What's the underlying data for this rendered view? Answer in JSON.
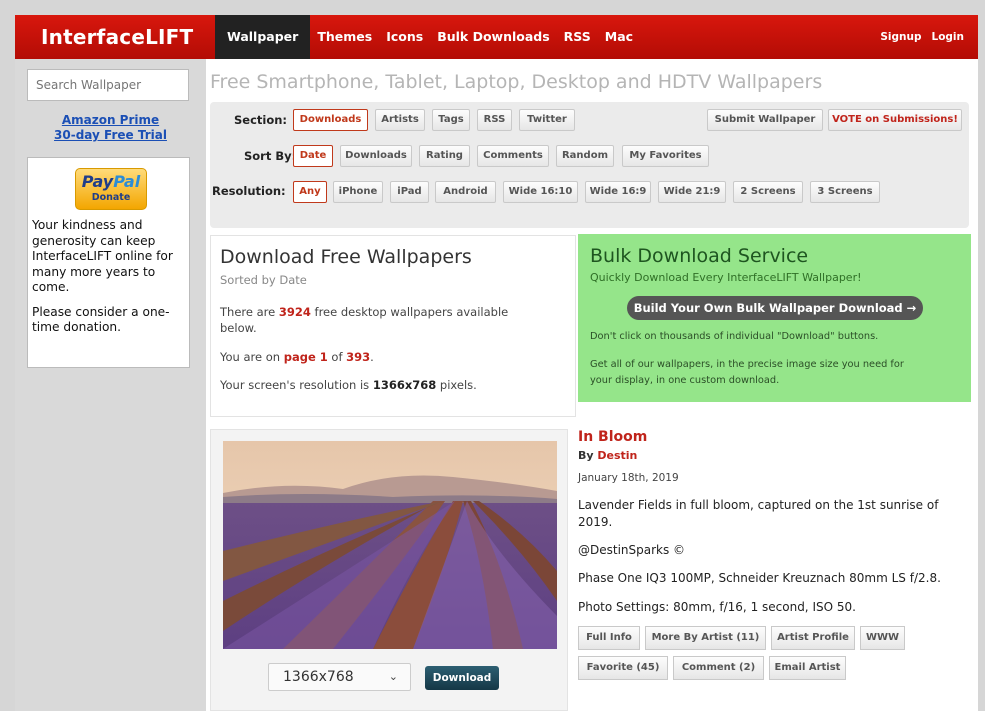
{
  "header": {
    "logo": "InterfaceLIFT",
    "nav": [
      "Wallpaper",
      "Themes",
      "Icons",
      "Bulk Downloads",
      "RSS",
      "Mac"
    ],
    "signup": "Signup",
    "login": "Login"
  },
  "sidebar": {
    "search_placeholder": "Search Wallpaper",
    "amazon_line1": "Amazon Prime",
    "amazon_line2": "30-day Free Trial",
    "paypal_pay": "Pay",
    "paypal_pal": "Pal",
    "paypal_donate": "Donate",
    "donate_p1": "Your kindness and generosity can keep InterfaceLIFT online for many more years to come.",
    "donate_p2": "Please consider a one-time donation."
  },
  "page_title": "Free Smartphone, Tablet, Laptop, Desktop and HDTV Wallpapers",
  "filters": {
    "section_label": "Section:",
    "section": [
      "Downloads",
      "Artists",
      "Tags",
      "RSS",
      "Twitter"
    ],
    "submit": "Submit Wallpaper",
    "vote": "VOTE on Submissions!",
    "sort_label": "Sort By:",
    "sort": [
      "Date",
      "Downloads",
      "Rating",
      "Comments",
      "Random",
      "My Favorites"
    ],
    "resolution_label": "Resolution:",
    "resolution": [
      "Any",
      "iPhone",
      "iPad",
      "Android",
      "Wide 16:10",
      "Wide 16:9",
      "Wide 21:9",
      "2 Screens",
      "3 Screens"
    ]
  },
  "download_info": {
    "title": "Download Free Wallpapers",
    "subtitle": "Sorted by Date",
    "count_pre": "There are ",
    "count": "3924",
    "count_post": " free desktop wallpapers available",
    "count_post2": "below.",
    "page_pre": "You are on ",
    "page": "page 1",
    "page_mid": " of ",
    "page_total": "393",
    "page_post": ".",
    "res_pre": "Your screen's resolution is ",
    "res": "1366x768",
    "res_post": " pixels."
  },
  "bulk": {
    "title": "Bulk Download Service",
    "tagline": "Quickly Download Every InterfaceLIFT Wallpaper!",
    "button": "Build Your Own Bulk Wallpaper Download →",
    "note1": "Don't click on thousands of individual \"Download\" buttons.",
    "note2a": "Get all of our wallpapers, in the precise image size you need for",
    "note2b": "your display, in one custom download."
  },
  "wallpaper": {
    "title": "In Bloom",
    "by_pre": "By ",
    "artist": "Destin",
    "date": "January 18th, 2019",
    "desc1": "Lavender Fields in full bloom, captured on the 1st sunrise of",
    "desc2": "2019.",
    "credit": "@DestinSparks ©",
    "camera": "Phase One IQ3 100MP, Schneider Kreuznach 80mm LS f/2.8.",
    "settings": "Photo Settings: 80mm, f/16, 1 second, ISO 50.",
    "resolution": "1366x768",
    "download": "Download",
    "actions": [
      "Full Info",
      "More By Artist (11)",
      "Artist Profile",
      "WWW",
      "Favorite (45)",
      "Comment (2)",
      "Email Artist"
    ]
  }
}
